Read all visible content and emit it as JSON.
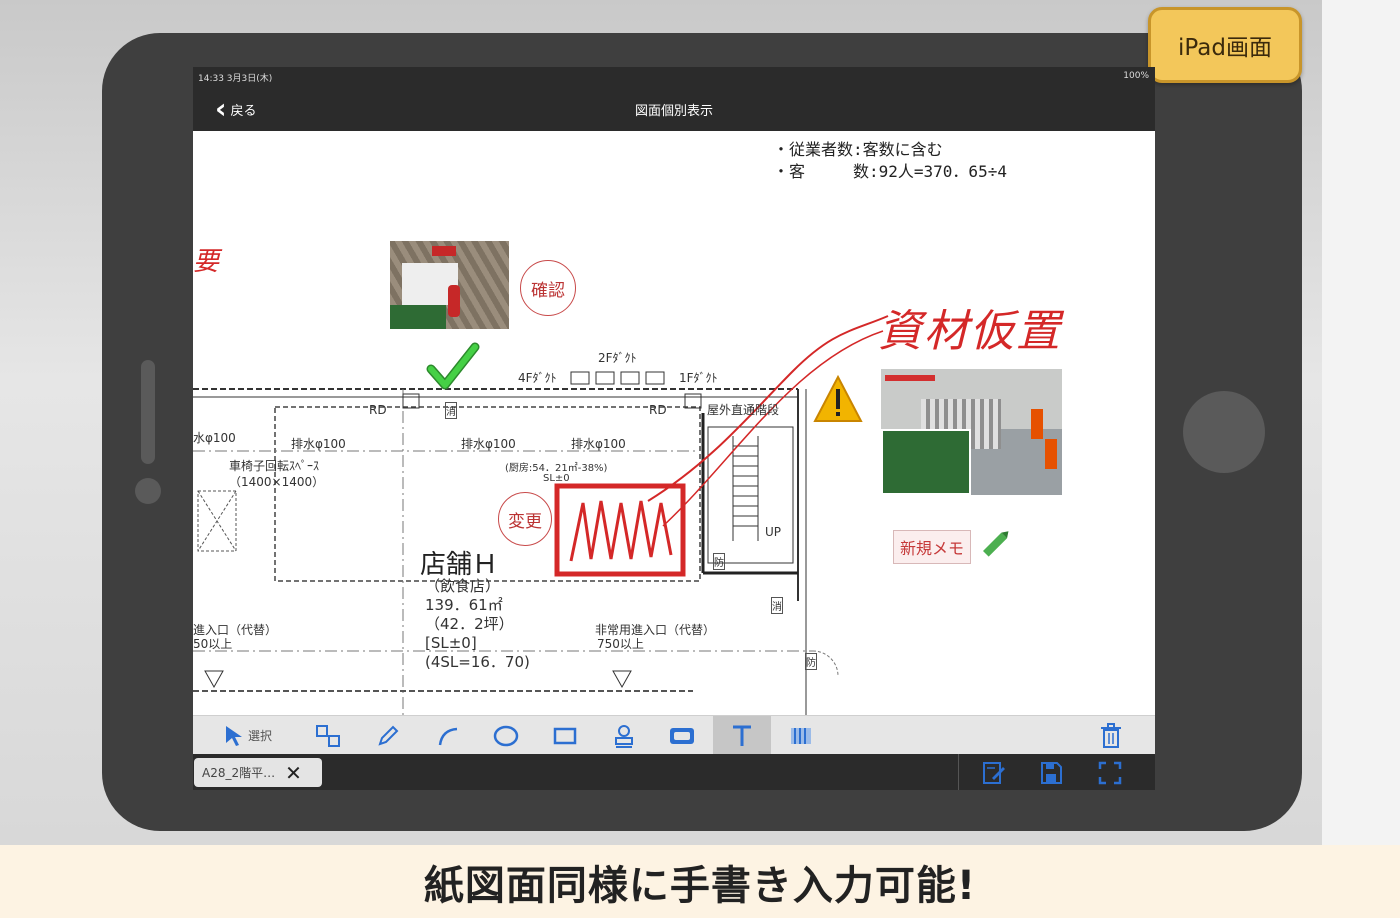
{
  "badge": {
    "label": "iPad画面"
  },
  "status_bar": {
    "time": "14:33  3月3日(木)",
    "right": "100%"
  },
  "nav": {
    "back_label": "戻る",
    "title": "図面個別表示"
  },
  "drawing": {
    "notes": [
      "・従業者数:客数に含む",
      "・客　　　数:92人=370．65÷4"
    ],
    "labels": {
      "duct_2f": "2Fﾀﾞｸﾄ",
      "duct_4f": "4Fﾀﾞｸﾄ",
      "duct_1f": "1Fﾀﾞｸﾄ",
      "rd_left": "RD",
      "rd_right": "RD",
      "drain_1": "水φ100",
      "drain_2": "排水φ100",
      "drain_3": "排水φ100",
      "drain_4": "排水φ100",
      "wheelchair": "車椅子回転ｽﾍﾟｰｽ",
      "wheelchair_size": "（1400×1400）",
      "kitchen": "(厨房:54．21㎡-38%)",
      "sl": "SL±0",
      "stairs": "屋外直通階段",
      "up": "UP",
      "entrance": "進入口（代替）",
      "entrance_size": "50以上",
      "emergency_entrance": "非常用進入口（代替）",
      "emergency_size": "750以上",
      "fire_1": "消",
      "fire_2": "消",
      "fire_3": "防",
      "fire_4": "防"
    },
    "shop": {
      "name": "店舗Ｈ",
      "details": "（飲食店）\n139．61㎡\n（42．2坪）\n[SL±0]\n(4SL=16．70)"
    },
    "stamp_confirm": "確認",
    "stamp_change": "変更",
    "handwriting": "資材仮置",
    "handwriting_left": "要",
    "memo": "新規メモ"
  },
  "toolbar": {
    "tools": [
      {
        "icon": "arrow-select-icon",
        "label": "選択"
      },
      {
        "icon": "group-shapes-icon"
      },
      {
        "icon": "pencil-icon"
      },
      {
        "icon": "curve-line-icon"
      },
      {
        "icon": "ellipse-icon"
      },
      {
        "icon": "rectangle-icon"
      },
      {
        "icon": "stamp-icon"
      },
      {
        "icon": "rounded-box-icon"
      },
      {
        "icon": "text-icon",
        "active": true
      },
      {
        "icon": "hatch-pattern-icon"
      }
    ],
    "trash": "trash-icon"
  },
  "tabs": {
    "active_file": "A28_2階平…"
  },
  "caption": "紙図面同様に手書き入力可能!",
  "colors": {
    "accent": "#2c6fd1",
    "markup_red": "#d42828",
    "badge": "#f3c75a",
    "check_green": "#3cc33c"
  }
}
